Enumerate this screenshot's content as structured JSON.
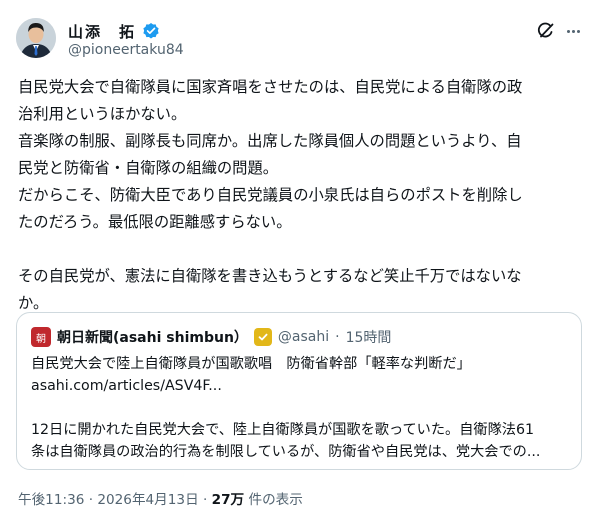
{
  "author": {
    "display_name": "山添　拓",
    "handle": "@pioneertaku84",
    "verified": true
  },
  "header_icons": [
    "grok-icon",
    "more-icon"
  ],
  "tweet": {
    "lines": [
      "自民党大会で自衛隊員に国家斉唱をさせたのは、自民党による自衛隊の政",
      "治利用というほかない。",
      "音楽隊の制服、副隊長も同席か。出席した隊員個人の問題というより、自",
      "民党と防衛省・自衛隊の組織の問題。",
      "だからこそ、防衛大臣であり自民党議員の小泉氏は自らのポストを削除し",
      "たのだろう。最低限の距離感すらない。",
      "",
      "その自民党が、憲法に自衛隊を書き込もうとするなど笑止千万ではないな",
      "か。"
    ]
  },
  "quote": {
    "logo_text": "朝",
    "logo_color": "#c0282d",
    "name": "朝日新聞(asahi shimbun）",
    "handle": "@asahi",
    "time": "15時間",
    "separator": "·",
    "lines": [
      "自民党大会で陸上自衛隊員が国歌歌唱　防衛省幹部「軽率な判断だ」",
      "asahi.com/articles/ASV4F...",
      "",
      "12日に開かれた自民党大会で、陸上自衛隊員が国歌を歌っていた。自衛隊法61",
      "条は自衛隊員の政治的行為を制限しているが、防衛省や自民党は、党大会での..."
    ]
  },
  "footer": {
    "time": "午後11:36",
    "separator": " · ",
    "date": "2026年4月13日",
    "views": "27万",
    "views_label": " 件の表示"
  },
  "colors": {
    "text": "#0f1419",
    "secondary": "#536471",
    "verified_blue": "#1d9bf0",
    "gold_badge": "#e2b719",
    "border": "#cfd9de"
  }
}
